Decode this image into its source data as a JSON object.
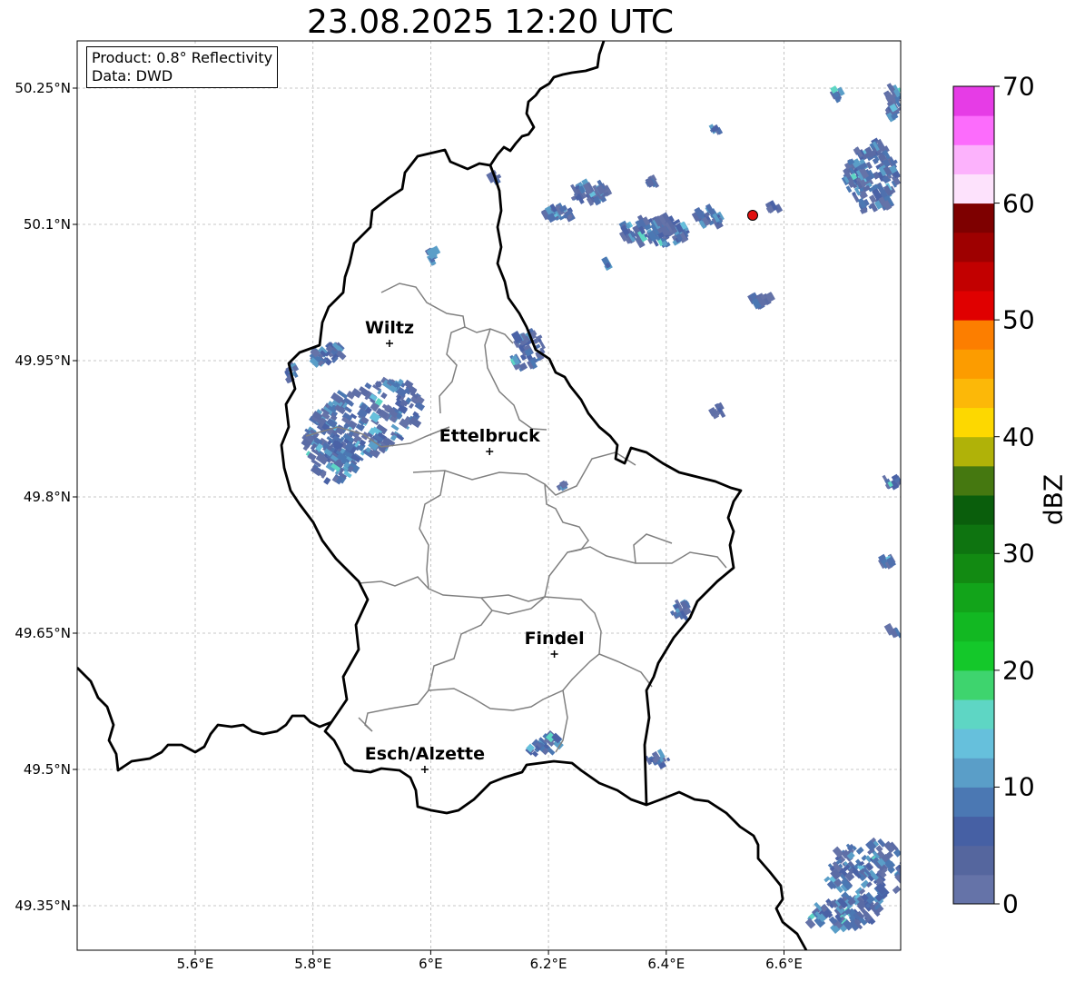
{
  "title": "23.08.2025 12:20 UTC",
  "info_box": {
    "product": "Product: 0.8° Reflectivity",
    "data": "Data: DWD"
  },
  "lat_labels": [
    "50.25°N",
    "50.1°N",
    "49.95°N",
    "49.8°N",
    "49.65°N",
    "49.5°N",
    "49.35°N"
  ],
  "lon_labels": [
    "5.6°E",
    "5.8°E",
    "6°E",
    "6.2°E",
    "6.4°E",
    "6.6°E"
  ],
  "places": [
    {
      "name": "Wiltz",
      "lon": 5.93,
      "lat": 49.969
    },
    {
      "name": "Ettelbruck",
      "lon": 6.1,
      "lat": 49.85
    },
    {
      "name": "Findel",
      "lon": 6.21,
      "lat": 49.627
    },
    {
      "name": "Esch/Alzette",
      "lon": 5.99,
      "lat": 49.5
    }
  ],
  "radar_site": {
    "lon": 6.55,
    "lat": 50.11,
    "color": "#e01010"
  },
  "colorbar": {
    "label": "dBZ",
    "ticks": [
      "0",
      "10",
      "20",
      "30",
      "40",
      "50",
      "60",
      "70"
    ],
    "range": [
      0,
      70
    ],
    "step": 2.5,
    "colors": [
      "#6573a8",
      "#55669e",
      "#4660a4",
      "#4b78b3",
      "#5a9ec8",
      "#66c0dc",
      "#5ed6c4",
      "#3ed46e",
      "#14c82a",
      "#12b822",
      "#12a41a",
      "#128a12",
      "#0e7410",
      "#0a5e0c",
      "#457810",
      "#b0b208",
      "#fdd800",
      "#fcb808",
      "#fc9c00",
      "#fc7e00",
      "#e00000",
      "#c20000",
      "#9e0000",
      "#7e0000",
      "#fde2fc",
      "#fcb2fc",
      "#fc6cfc",
      "#e63ce6"
    ]
  }
}
